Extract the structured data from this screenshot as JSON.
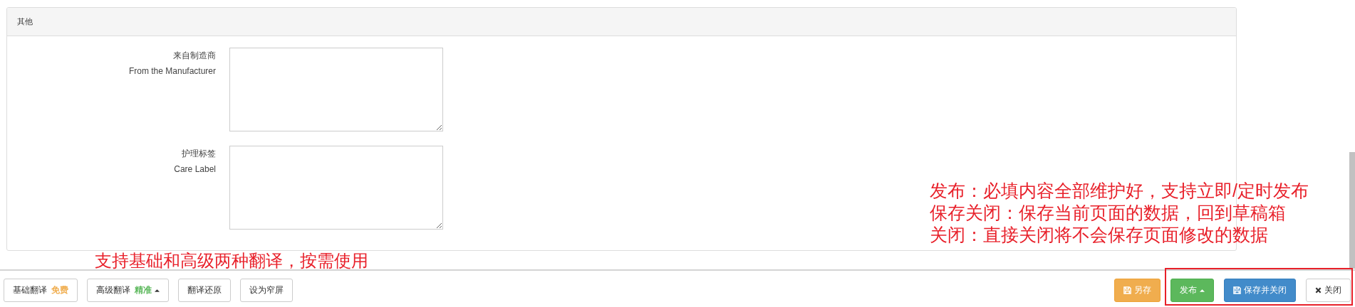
{
  "panel": {
    "title": "其他",
    "fields": [
      {
        "label": "来自制造商",
        "label_en": "From the Manufacturer"
      },
      {
        "label": "护理标签",
        "label_en": "Care Label"
      }
    ]
  },
  "toolbar": {
    "left": [
      {
        "kind": "default",
        "label": "基础翻译",
        "tag": {
          "text": "免费",
          "color": "#f0ad4e"
        },
        "caret": false
      },
      {
        "kind": "default",
        "label": "高级翻译",
        "tag": {
          "text": "精准",
          "color": "#5cb85c"
        },
        "caret": true
      },
      {
        "kind": "default",
        "label": "翻译还原",
        "caret": false
      },
      {
        "kind": "default",
        "label": "设为窄屏",
        "caret": false
      }
    ],
    "right": [
      {
        "kind": "save-as",
        "label": "另存",
        "caret": false
      },
      {
        "kind": "publish",
        "label": "发布",
        "caret": true
      },
      {
        "kind": "save-close",
        "label": "保存并关闭",
        "caret": false
      },
      {
        "kind": "close",
        "label": "关闭",
        "caret": false
      }
    ]
  },
  "annotations": {
    "left": [
      "支持基础和高级两种翻译，按需使用"
    ],
    "right": [
      "发布：必填内容全部维护好，支持立即/定时发布",
      "保存关闭：保存当前页面的数据，回到草稿箱",
      "关闭：直接关闭将不会保存页面修改的数据"
    ]
  }
}
